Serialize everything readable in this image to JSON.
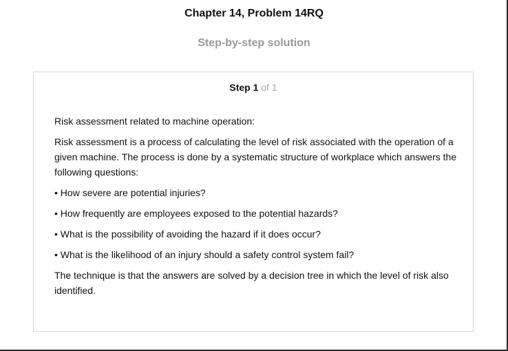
{
  "header": {
    "chapter_title": "Chapter 14, Problem 14RQ",
    "subtitle": "Step-by-step solution"
  },
  "step": {
    "label": "Step 1",
    "of": "of 1"
  },
  "content": {
    "heading": "Risk assessment related to machine operation:",
    "intro": "Risk assessment is a process of calculating the level of risk associated with the operation of a given machine. The process is done by a systematic structure of workplace which answers the following questions:",
    "bullets": [
      "• How severe are potential injuries?",
      "• How frequently are employees exposed to the potential hazards?",
      "• What is the possibility of avoiding the hazard if it does occur?",
      "• What is the likelihood of an injury should a safety control system fail?"
    ],
    "conclusion": "The technique is that the answers are solved by a decision tree in which the level of risk also identified."
  }
}
